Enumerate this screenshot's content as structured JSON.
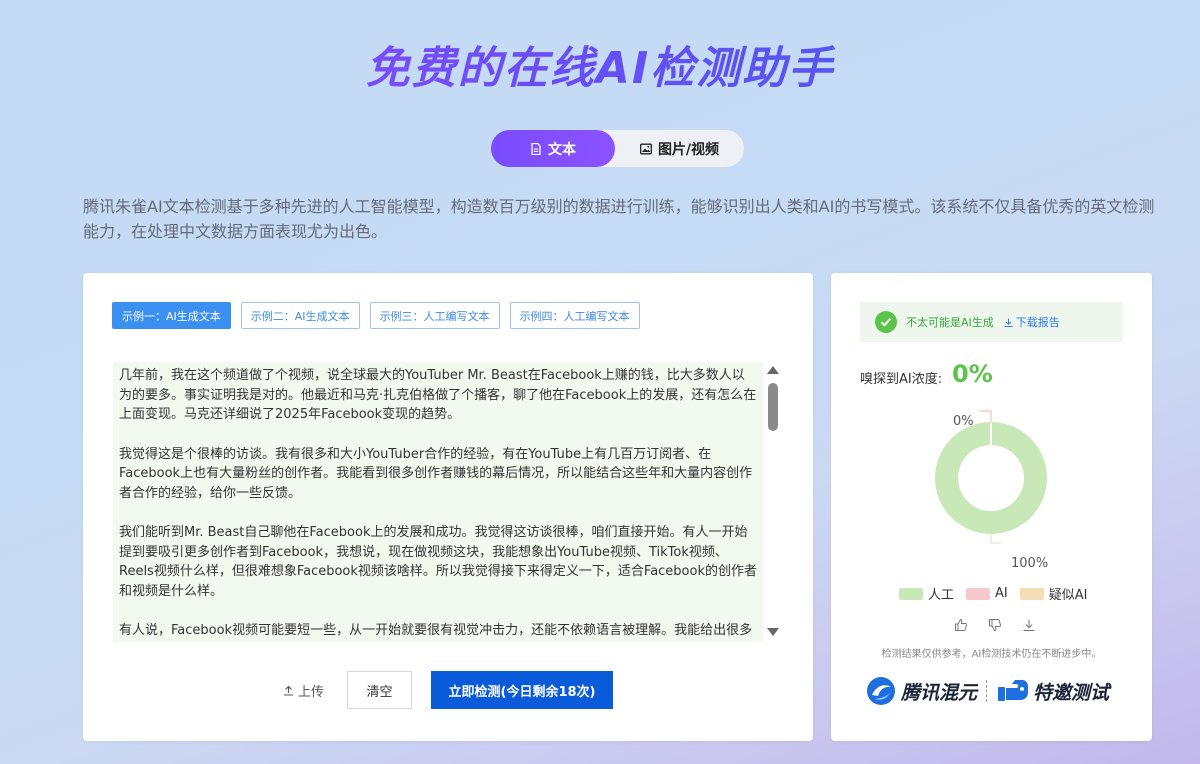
{
  "header": {
    "title": "免费的在线AI检测助手"
  },
  "tabs": [
    {
      "label": "文本",
      "icon": "document-icon",
      "active": true
    },
    {
      "label": "图片/视频",
      "icon": "image-icon",
      "active": false
    }
  ],
  "description": "腾讯朱雀AI文本检测基于多种先进的人工智能模型，构造数百万级别的数据进行训练，能够识别出人类和AI的书写模式。该系统不仅具备优秀的英文检测能力，在处理中文数据方面表现尤为出色。",
  "examples": [
    {
      "label": "示例一：AI生成文本",
      "active": true
    },
    {
      "label": "示例二：AI生成文本",
      "active": false
    },
    {
      "label": "示例三：人工编写文本",
      "active": false
    },
    {
      "label": "示例四：人工编写文本",
      "active": false
    }
  ],
  "editor": {
    "paragraphs": [
      "几年前，我在这个频道做了个视频，说全球最大的YouTuber Mr. Beast在Facebook上赚的钱，比大多数人以为的要多。事实证明我是对的。他最近和马克·扎克伯格做了个播客，聊了他在Facebook上的发展，还有怎么在上面变现。马克还详细说了2025年Facebook变现的趋势。",
      "我觉得这是个很棒的访谈。我有很多和大小YouTuber合作的经验，有在YouTube上有几百万订阅者、在Facebook上也有大量粉丝的创作者。我能看到很多创作者赚钱的幕后情况，所以能结合这些年和大量内容创作者合作的经验，给你一些反馈。",
      "我们能听到Mr. Beast自己聊他在Facebook上的发展和成功。我觉得这访谈很棒，咱们直接开始。有人一开始提到要吸引更多创作者到Facebook，我想说，现在做视频这块，我能想象出YouTube视频、TikTok视频、Reels视频什么样，但很难想象Facebook视频该啥样。所以我觉得接下来得定义一下，适合Facebook的创作者和视频是什么样。",
      "有人说，Facebook视频可能要短一些，从一开始就要很有视觉冲击力，还能不依赖语言被理解。我能给出很多"
    ]
  },
  "actions": {
    "upload_label": "上传",
    "clear_label": "清空",
    "detect_label": "立即检测(今日剩余18次)"
  },
  "result": {
    "verdict": "不太可能是AI生成",
    "download_label": "下载报告",
    "concentration_label": "嗅探到AI浓度:",
    "concentration_value": "0%",
    "note": "检测结果仅供参考，AI检测技术仍在不断进步中。",
    "brand_left": "腾讯混元",
    "brand_right": "特邀测试"
  },
  "chart_data": {
    "type": "pie",
    "categories": [
      "人工",
      "AI",
      "疑似AI"
    ],
    "values": [
      100,
      0,
      0
    ],
    "labels": [
      "100%",
      "0%"
    ],
    "colors": [
      "#c9e8b8",
      "#f8c9cc",
      "#f5dcb5"
    ],
    "legend_position": "bottom"
  }
}
